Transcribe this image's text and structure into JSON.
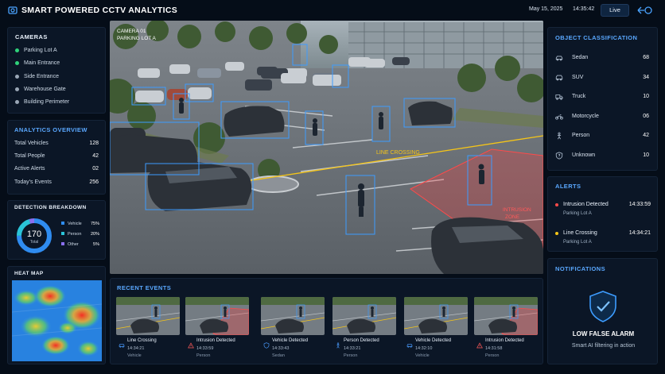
{
  "header": {
    "title": "SMART POWERED CCTV ANALYTICS",
    "date": "May 15, 2025",
    "time": "14:35:42",
    "live_label": "Live"
  },
  "cameras": {
    "title": "CAMERAS",
    "items": [
      {
        "label": "Parking Lot A",
        "status_color": "#2fd27a"
      },
      {
        "label": "Main Entrance",
        "status_color": "#2fd27a"
      },
      {
        "label": "Side Entrance",
        "status_color": "#9aa7b6"
      },
      {
        "label": "Warehouse Gate",
        "status_color": "#9aa7b6"
      },
      {
        "label": "Building Perimeter",
        "status_color": "#9aa7b6"
      }
    ]
  },
  "analytics": {
    "title": "ANALYTICS OVERVIEW",
    "rows": [
      {
        "label": "Total Vehicles",
        "value": "128"
      },
      {
        "label": "Total People",
        "value": "42"
      },
      {
        "label": "Active Alerts",
        "value": "02"
      },
      {
        "label": "Today's Events",
        "value": "256"
      }
    ]
  },
  "detection": {
    "title": "DETECTION BREAKDOWN",
    "total_value": "170",
    "total_label": "Total",
    "segments": [
      {
        "label": "Vehicle",
        "value": "75%",
        "fraction": 0.75,
        "color": "#2f8cf0"
      },
      {
        "label": "Person",
        "value": "20%",
        "fraction": 0.2,
        "color": "#2ac4d8"
      },
      {
        "label": "Other",
        "value": "5%",
        "fraction": 0.05,
        "color": "#8a6ff0"
      }
    ]
  },
  "heatmap": {
    "title": "HEAT MAP"
  },
  "camera_view": {
    "camera_id": "CAMERA 01",
    "location": "PARKING LOT A",
    "line_label": "LINE CROSSING",
    "zone_label_1": "INTRUSION",
    "zone_label_2": "ZONE"
  },
  "classification": {
    "title": "OBJECT CLASSIFICATION",
    "items": [
      {
        "label": "Sedan",
        "value": "68",
        "icon": "car-icon"
      },
      {
        "label": "SUV",
        "value": "34",
        "icon": "suv-icon"
      },
      {
        "label": "Truck",
        "value": "10",
        "icon": "truck-icon"
      },
      {
        "label": "Motorcycle",
        "value": "06",
        "icon": "motorcycle-icon"
      },
      {
        "label": "Person",
        "value": "42",
        "icon": "person-icon"
      },
      {
        "label": "Unknown",
        "value": "10",
        "icon": "shield-question-icon"
      }
    ]
  },
  "alerts": {
    "title": "ALERTS",
    "items": [
      {
        "label": "Intrusion Detected",
        "time": "14:33:59",
        "location": "Parking Lot A",
        "color": "#ff4a4a"
      },
      {
        "label": "Line Crossing",
        "time": "14:34:21",
        "location": "Parking Lot A",
        "color": "#f5c518"
      }
    ]
  },
  "notifications": {
    "title": "NOTIFICATIONS",
    "headline": "LOW FALSE ALARM",
    "subtext": "Smart AI filtering in action"
  },
  "events": {
    "title": "RECENT EVENTS",
    "items": [
      {
        "title": "Line Crossing",
        "time": "14:34:21",
        "type": "Vehicle",
        "icon": "car-icon",
        "accent": "#4a9cff"
      },
      {
        "title": "Intrusion Detected",
        "time": "14:33:59",
        "type": "Person",
        "icon": "warning-icon",
        "accent": "#ff5a5a"
      },
      {
        "title": "Vehicle Detected",
        "time": "14:33:43",
        "type": "Sedan",
        "icon": "shield-icon",
        "accent": "#4a9cff"
      },
      {
        "title": "Person Detected",
        "time": "14:33:21",
        "type": "Person",
        "icon": "person-icon",
        "accent": "#4a9cff"
      },
      {
        "title": "Vehicle Detected",
        "time": "14:32:10",
        "type": "Vehicle",
        "icon": "car-icon",
        "accent": "#4a9cff"
      },
      {
        "title": "Intrusion Detected",
        "time": "14:31:58",
        "type": "Person",
        "icon": "warning-icon",
        "accent": "#ff5a5a"
      }
    ]
  }
}
